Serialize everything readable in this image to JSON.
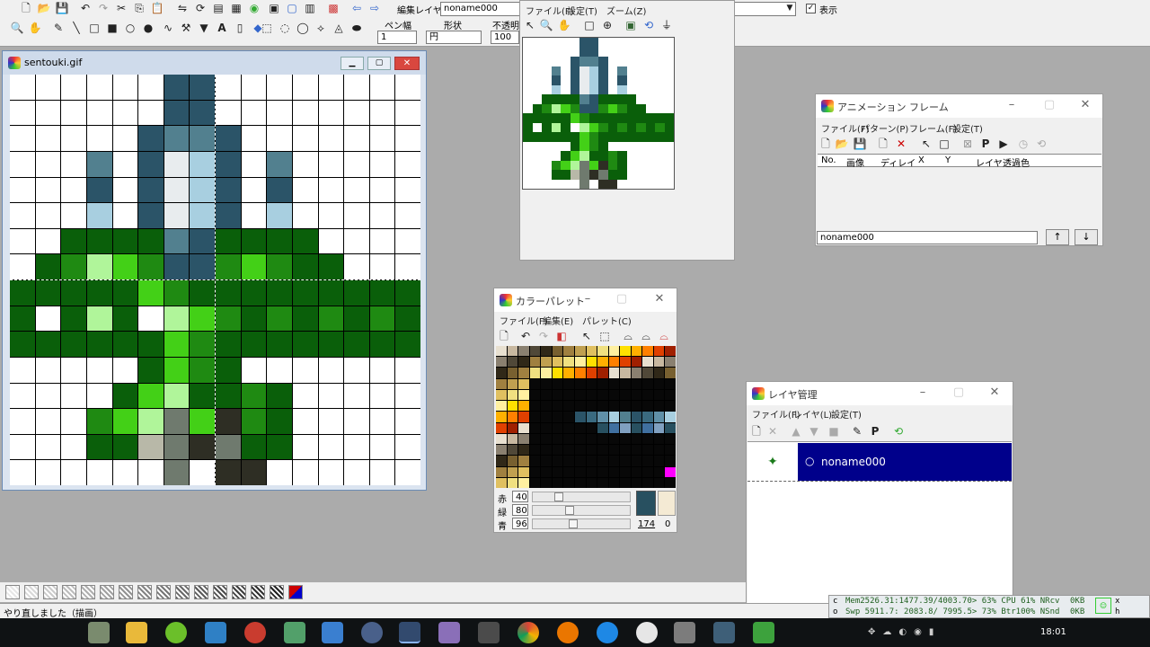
{
  "toolbar": {
    "edit_layer_label": "編集レイヤ",
    "edit_layer_value": "noname000",
    "display_label": "表示",
    "pen_width_label": "ペン幅",
    "pen_width_value": "1",
    "shape_label": "形状",
    "shape_value": "円",
    "opacity_label": "不透明",
    "opacity_value": "100"
  },
  "canvas_window": {
    "title": "sentouki.gif"
  },
  "preview_window": {
    "menu": [
      "ファイル(F)",
      "設定(T)",
      "ズーム(Z)"
    ]
  },
  "animation_window": {
    "title": "アニメーション フレーム",
    "menu": [
      "ファイル(F)",
      "パターン(P)",
      "フレーム(F)",
      "設定(T)"
    ],
    "columns": [
      "No.",
      "画像",
      "ディレイ",
      "X",
      "Y",
      "レイヤ",
      "透過色"
    ],
    "pattern_value": "noname000",
    "up_label": "↑",
    "down_label": "↓"
  },
  "palette_window": {
    "title": "カラーパレット",
    "menu": [
      "ファイル(F)",
      "編集(E)",
      "パレット(C)"
    ],
    "red_label": "赤",
    "red_value": "40",
    "green_label": "緑",
    "green_value": "80",
    "blue_label": "青",
    "blue_value": "96",
    "index_value": "174",
    "alpha_value": "0"
  },
  "layer_window": {
    "title": "レイヤ管理",
    "menu": [
      "ファイル(F)",
      "レイヤ(L)",
      "設定(T)"
    ],
    "layer_name": "noname000",
    "visible_marker": "○"
  },
  "status": {
    "message": "やり直しました（描画）",
    "mem_line": "Mem2526.31:1477.39/4003.70> 63% CPU 61% NRcv",
    "mem_kb": "0KB",
    "swp_line": "Swp 5911.7: 2083.8/ 7995.5> 73% Btr100% NSnd",
    "swp_kb": "0KB",
    "c_label": "c",
    "o_label": "o",
    "x_label": "x",
    "h_label": "h"
  },
  "taskbar": {
    "time": "18:01"
  },
  "colors": {
    "accent_dark_blue": "#00008b",
    "sprite_dark_green": "#0a5f0a",
    "sprite_bright_green": "#43d017",
    "sprite_slate": "#2b5468"
  }
}
